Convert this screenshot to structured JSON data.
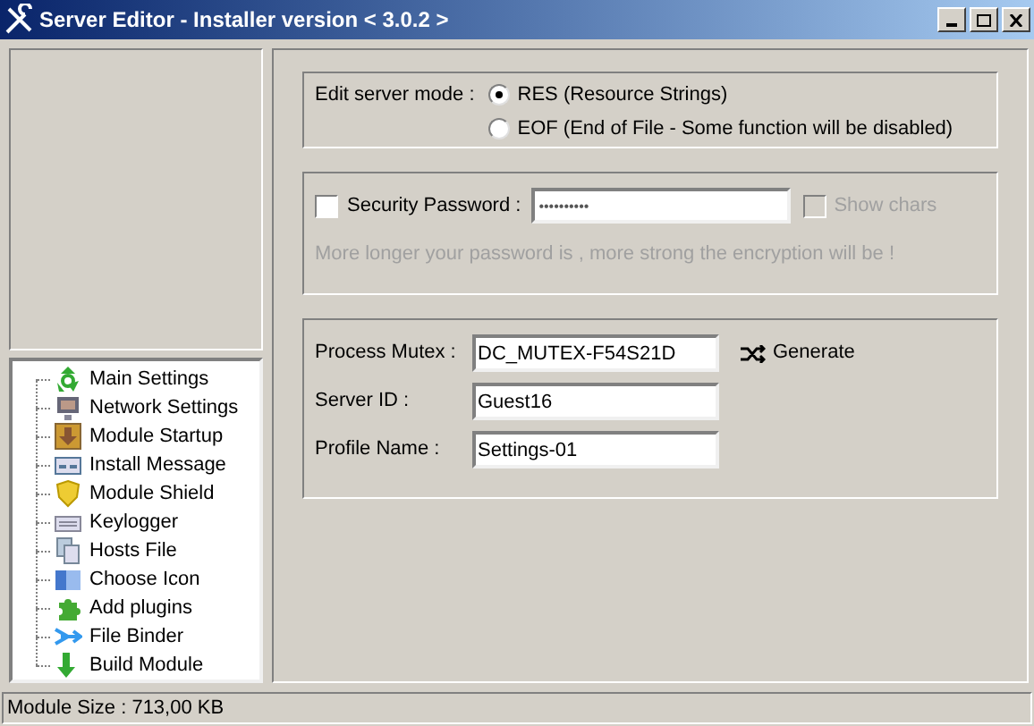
{
  "window": {
    "title": "Server Editor - Installer version < 3.0.2 >"
  },
  "tree": {
    "items": [
      {
        "label": "Main Settings",
        "selected": false
      },
      {
        "label": "Network Settings",
        "selected": false
      },
      {
        "label": "Module Startup",
        "selected": false
      },
      {
        "label": "Install Message",
        "selected": false
      },
      {
        "label": "Module Shield",
        "selected": false
      },
      {
        "label": "Keylogger",
        "selected": false
      },
      {
        "label": "Hosts File",
        "selected": false
      },
      {
        "label": "Choose Icon",
        "selected": false
      },
      {
        "label": "Add plugins",
        "selected": false
      },
      {
        "label": "File Binder",
        "selected": false
      },
      {
        "label": "Build Module",
        "selected": false
      }
    ]
  },
  "mode": {
    "label": "Edit server mode :",
    "options": [
      {
        "label": "RES (Resource Strings)",
        "selected": true
      },
      {
        "label": "EOF (End of File - Some function will be disabled)",
        "selected": false
      }
    ]
  },
  "security": {
    "label": "Security Password :",
    "checked": false,
    "value": "••••••••••",
    "show_chars": {
      "label": "Show chars",
      "checked": false,
      "disabled": true
    },
    "hint": "More longer your password is , more strong the encryption will be !",
    "hint_disabled": true
  },
  "fields": [
    {
      "label": "Process Mutex :",
      "value": "DC_MUTEX-F54S21D"
    },
    {
      "label": "Server ID :",
      "value": "Guest16"
    },
    {
      "label": "Profile Name :",
      "value": "Settings-01"
    }
  ],
  "generate_button": "Generate",
  "status_bar": "Module Size : 713,00 KB"
}
